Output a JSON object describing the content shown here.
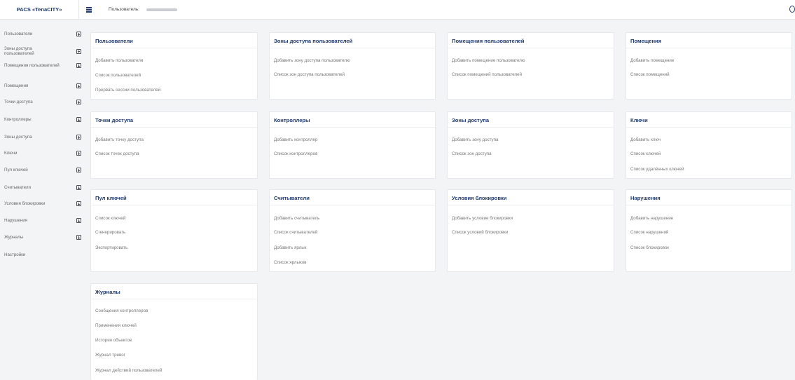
{
  "header": {
    "brand": "PACS «TenaCITY»",
    "user_label": "Пользователь:"
  },
  "sidebar": {
    "items": [
      {
        "label": "Пользователи"
      },
      {
        "label": "Зоны доступа пользователей"
      },
      {
        "label": "Помещения пользователей"
      },
      {
        "label": "Помещения"
      },
      {
        "label": "Точки доступа"
      },
      {
        "label": "Контроллеры"
      },
      {
        "label": "Зоны доступа"
      },
      {
        "label": "Ключи"
      },
      {
        "label": "Пул ключей"
      },
      {
        "label": "Считыватели"
      },
      {
        "label": "Условия блокировки"
      },
      {
        "label": "Нарушения"
      },
      {
        "label": "Журналы"
      },
      {
        "label": "Настройки"
      }
    ]
  },
  "cards": [
    {
      "title": "Пользователи",
      "links": [
        "Добавить пользователя",
        "Список пользователей",
        "Прервать сессии пользователей"
      ]
    },
    {
      "title": "Зоны доступа пользователей",
      "links": [
        "Добавить зону доступа пользователю",
        "Список зон доступа пользователей"
      ]
    },
    {
      "title": "Помещения пользователей",
      "links": [
        "Добавить помещение пользователю",
        "Список помещений пользователей"
      ]
    },
    {
      "title": "Помещения",
      "links": [
        "Добавить помещение",
        "Список помещений"
      ]
    },
    {
      "title": "Точки доступа",
      "links": [
        "Добавить точку доступа",
        "Список точек доступа"
      ]
    },
    {
      "title": "Контроллеры",
      "links": [
        "Добавить контроллер",
        "Список контроллеров"
      ]
    },
    {
      "title": "Зоны доступа",
      "links": [
        "Добавить зону доступа",
        "Список зон доступа"
      ]
    },
    {
      "title": "Ключи",
      "links": [
        "Добавить ключ",
        "Список ключей",
        "Список удалённых ключей"
      ]
    },
    {
      "title": "Пул ключей",
      "links": [
        "Список ключей",
        "Сгенерировать",
        "Экспортировать"
      ]
    },
    {
      "title": "Считыватели",
      "links": [
        "Добавить считыватель",
        "Список считывателей",
        "Добавить ярлык",
        "Список ярлыков"
      ]
    },
    {
      "title": "Условия блокировки",
      "links": [
        "Добавить условие блокировки",
        "Список условий блокировки"
      ]
    },
    {
      "title": "Нарушения",
      "links": [
        "Добавить нарушение",
        "Список нарушений",
        "Список блокировок"
      ]
    },
    {
      "title": "Журналы",
      "links": [
        "Сообщения контроллеров",
        "Применения ключей",
        "История объектов",
        "Журнал тревог",
        "Журнал действий пользователей"
      ]
    }
  ]
}
